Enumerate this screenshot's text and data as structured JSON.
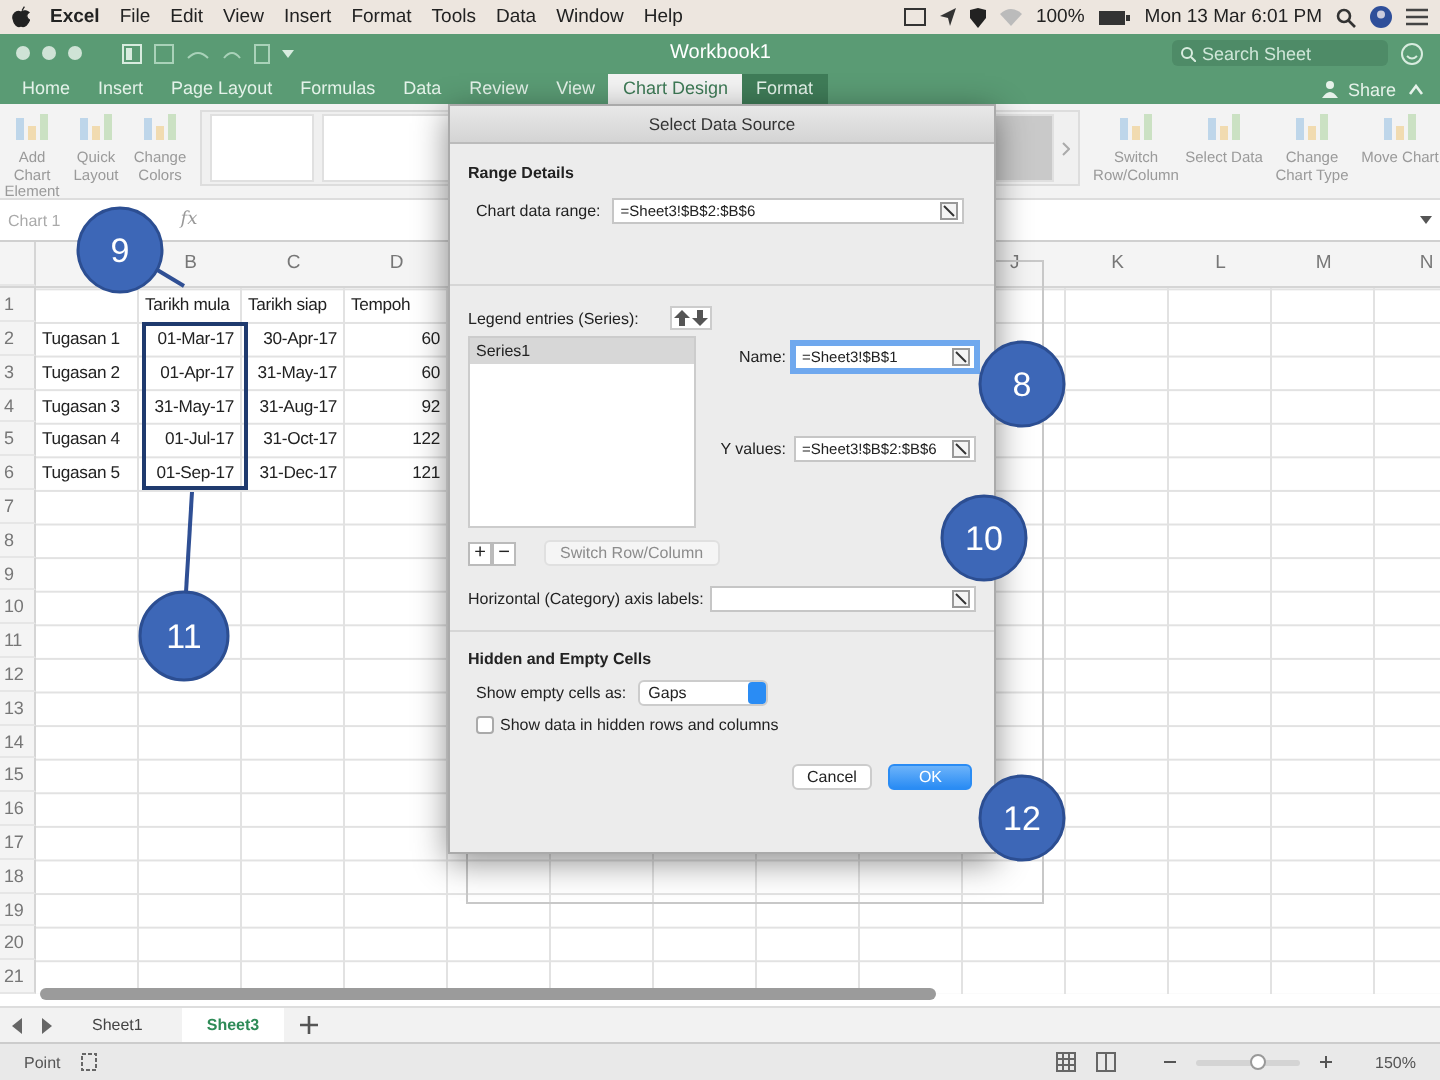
{
  "menu_bar": {
    "app": "Excel",
    "items": [
      "File",
      "Edit",
      "View",
      "Insert",
      "Format",
      "Tools",
      "Data",
      "Window",
      "Help"
    ],
    "battery": "100%",
    "clock": "Mon 13 Mar  6:01 PM"
  },
  "window": {
    "title": "Workbook1",
    "search": {
      "placeholder": "Search Sheet"
    }
  },
  "ribbon_tabs": [
    {
      "label": "Home",
      "selected": false,
      "kind": "normal"
    },
    {
      "label": "Insert",
      "selected": false,
      "kind": "normal"
    },
    {
      "label": "Page Layout",
      "selected": false,
      "kind": "normal"
    },
    {
      "label": "Formulas",
      "selected": false,
      "kind": "normal"
    },
    {
      "label": "Data",
      "selected": false,
      "kind": "normal"
    },
    {
      "label": "Review",
      "selected": false,
      "kind": "normal"
    },
    {
      "label": "View",
      "selected": false,
      "kind": "normal"
    },
    {
      "label": "Chart Design",
      "selected": true,
      "kind": "contextual"
    },
    {
      "label": "Format",
      "selected": false,
      "kind": "contextual"
    }
  ],
  "share": "Share",
  "ribbon_left": [
    {
      "label": "Add Chart Element",
      "disabled": true
    },
    {
      "label": "Quick Layout",
      "disabled": true
    },
    {
      "label": "Change Colors",
      "disabled": true
    }
  ],
  "ribbon_right": [
    {
      "label": "Switch Row/Column",
      "disabled": true
    },
    {
      "label": "Select Data",
      "disabled": true
    },
    {
      "label": "Change Chart Type",
      "disabled": true
    },
    {
      "label": "Move Chart",
      "disabled": true
    }
  ],
  "formula_bar": {
    "name_box": "Chart 1",
    "function_icon": "fx"
  },
  "sheet": {
    "column_headers_left": [
      "B",
      "C",
      "D"
    ],
    "column_headers_right": [
      "J",
      "K",
      "L",
      "M",
      "N"
    ],
    "rows": [
      {
        "number": "1",
        "B": {
          "text": "Tarikh mula",
          "kind": "text"
        },
        "C": {
          "text": "Tarikh siap",
          "kind": "text"
        },
        "D": {
          "text": "Tempoh",
          "kind": "text"
        }
      },
      {
        "number": "2",
        "A": {
          "text": "Tugasan 1",
          "kind": "text"
        },
        "B": {
          "text": "01-Mar-17",
          "kind": "date"
        },
        "C": {
          "text": "30-Apr-17",
          "kind": "date"
        },
        "D": {
          "text": "60",
          "kind": "number"
        }
      },
      {
        "number": "3",
        "A": {
          "text": "Tugasan 2",
          "kind": "text"
        },
        "B": {
          "text": "01-Apr-17",
          "kind": "date"
        },
        "C": {
          "text": "31-May-17",
          "kind": "date"
        },
        "D": {
          "text": "60",
          "kind": "number"
        }
      },
      {
        "number": "4",
        "A": {
          "text": "Tugasan 3",
          "kind": "text"
        },
        "B": {
          "text": "31-May-17",
          "kind": "date"
        },
        "C": {
          "text": "31-Aug-17",
          "kind": "date"
        },
        "D": {
          "text": "92",
          "kind": "number"
        }
      },
      {
        "number": "5",
        "A": {
          "text": "Tugasan 4",
          "kind": "text"
        },
        "B": {
          "text": "01-Jul-17",
          "kind": "date"
        },
        "C": {
          "text": "31-Oct-17",
          "kind": "date"
        },
        "D": {
          "text": "122",
          "kind": "number"
        }
      },
      {
        "number": "6",
        "A": {
          "text": "Tugasan 5",
          "kind": "text"
        },
        "B": {
          "text": "01-Sep-17",
          "kind": "date"
        },
        "C": {
          "text": "31-Dec-17",
          "kind": "date"
        },
        "D": {
          "text": "121",
          "kind": "number"
        }
      },
      {
        "number": "7"
      },
      {
        "number": "8"
      },
      {
        "number": "9"
      },
      {
        "number": "10"
      },
      {
        "number": "11"
      },
      {
        "number": "12"
      },
      {
        "number": "13"
      },
      {
        "number": "14"
      },
      {
        "number": "15"
      },
      {
        "number": "16"
      },
      {
        "number": "17"
      },
      {
        "number": "18"
      },
      {
        "number": "19"
      },
      {
        "number": "20"
      },
      {
        "number": "21"
      }
    ]
  },
  "sheet_tabs": [
    {
      "label": "Sheet1",
      "selected": false
    },
    {
      "label": "Sheet3",
      "selected": true
    }
  ],
  "status_bar": {
    "mode": "Point",
    "zoom": {
      "level": 0.6,
      "reading": "150%"
    }
  },
  "dialog": {
    "title": "Select Data Source",
    "range_heading": "Range Details",
    "range_label": "Chart data range:",
    "range_value": "=Sheet3!$B$2:$B$6",
    "legend_label": "Legend entries (Series):",
    "series": [
      {
        "label": "Series1",
        "selected": true
      }
    ],
    "series_fields": [
      {
        "label": "Name:",
        "value": "=Sheet3!$B$1",
        "focused": true
      },
      {
        "label": "Y values:",
        "value": "=Sheet3!$B$2:$B$6",
        "focused": false
      }
    ],
    "add": "+",
    "remove": "−",
    "switch_button": {
      "label": "Switch Row/Column",
      "disabled": true
    },
    "axis_label": "Horizontal (Category) axis labels:",
    "hidden_heading": "Hidden and Empty Cells",
    "empty_label": "Show empty cells as:",
    "empty_value": "Gaps",
    "hidden_checkbox": {
      "label": "Show data in hidden rows and columns",
      "checked": false
    },
    "buttons": [
      {
        "label": "Cancel",
        "default": false
      },
      {
        "label": "OK",
        "default": true
      }
    ]
  },
  "callouts": [
    {
      "label": "9"
    },
    {
      "label": "11"
    },
    {
      "label": "8"
    },
    {
      "label": "10"
    },
    {
      "label": "12"
    }
  ]
}
